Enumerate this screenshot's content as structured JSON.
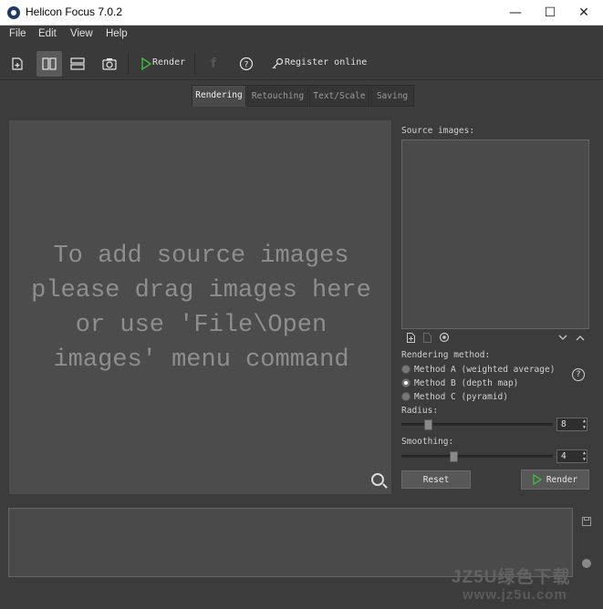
{
  "window": {
    "title": "Helicon Focus 7.0.2",
    "minimize_glyph": "—",
    "maximize_glyph": "☐",
    "close_glyph": "✕"
  },
  "menu": [
    "File",
    "Edit",
    "View",
    "Help"
  ],
  "toolbar": {
    "render_label": "Render",
    "register_label": "Register online"
  },
  "tabs": [
    {
      "label": "Rendering",
      "active": true
    },
    {
      "label": "Retouching",
      "active": false
    },
    {
      "label": "Text/Scale",
      "active": false
    },
    {
      "label": "Saving",
      "active": false
    }
  ],
  "preview": {
    "hint": "To add source images\nplease drag images here\nor use 'File\\Open\nimages' menu command"
  },
  "source": {
    "label": "Source images:"
  },
  "rendering": {
    "method_label": "Rendering method:",
    "methods": [
      {
        "label": "Method A (weighted average)",
        "selected": false
      },
      {
        "label": "Method B (depth map)",
        "selected": true
      },
      {
        "label": "Method C (pyramid)",
        "selected": false
      }
    ],
    "radius_label": "Radius:",
    "radius_value": "8",
    "radius_fraction": 0.16,
    "smoothing_label": "Smoothing:",
    "smoothing_value": "4",
    "smoothing_fraction": 0.34,
    "reset_label": "Reset",
    "render_label": "Render"
  },
  "watermark": {
    "line1": "JZ5U绿色下载",
    "line2": "www.jz5u.com"
  },
  "colors": {
    "accent_green": "#3fbf3f",
    "panel_bg": "#3c3c3c"
  }
}
